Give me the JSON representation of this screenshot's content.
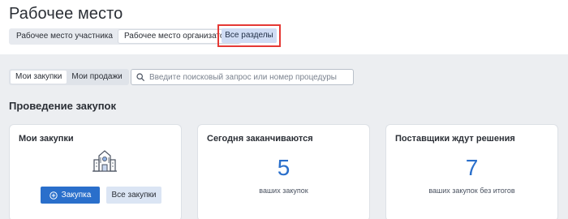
{
  "header": {
    "title": "Рабочее место",
    "roles": [
      {
        "label": "Рабочее место участника",
        "active": false
      },
      {
        "label": "Рабочее место организатора",
        "active": true
      }
    ],
    "all_sections_label": "Все разделы"
  },
  "filters": {
    "tabs": [
      {
        "label": "Мои закупки",
        "active": true
      },
      {
        "label": "Мои продажи",
        "active": false
      }
    ],
    "search": {
      "placeholder": "Введите поисковый запрос или номер процедуры",
      "value": ""
    }
  },
  "section": {
    "title": "Проведение закупок"
  },
  "cards": {
    "my_purchases": {
      "title": "Мои закупки",
      "icon": "building-icon",
      "create_label": "Закупка",
      "all_label": "Все закупки"
    },
    "ending_today": {
      "title": "Сегодня заканчиваются",
      "value": "5",
      "caption": "ваших закупок"
    },
    "awaiting_decision": {
      "title": "Поставщики ждут решения",
      "value": "7",
      "caption": "ваших закупок без итогов"
    }
  },
  "colors": {
    "accent": "#2a6fcb",
    "highlight": "#e53935",
    "background": "#eceef1"
  }
}
